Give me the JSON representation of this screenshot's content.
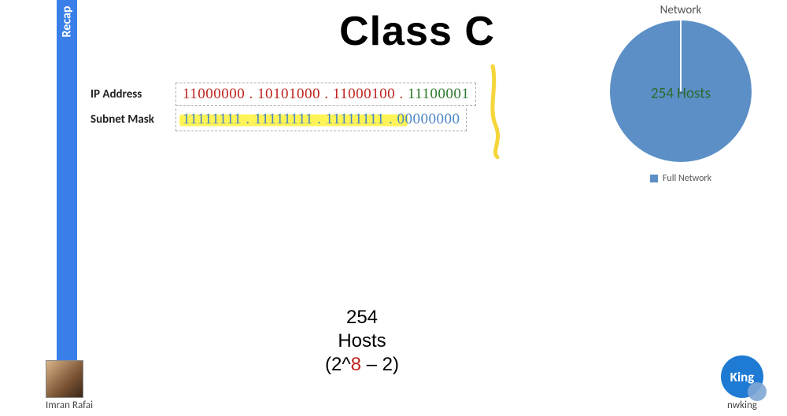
{
  "sidebar": {
    "label": "Recap"
  },
  "title": "Class C",
  "rows": {
    "ip": {
      "label": "IP Address",
      "network_bits": "11000000 . 10101000 . 11000100 .",
      "host_bits": " 11100001"
    },
    "mask": {
      "label": "Subnet Mask",
      "ones": "11111111 . 11111111 . 11111111 .",
      "zeros": " 00000000"
    }
  },
  "hostcalc": {
    "line1": "254",
    "line2": "Hosts",
    "formula_pre": "(2^",
    "formula_exp": "8",
    "formula_post": " – 2)"
  },
  "chart_data": {
    "type": "pie",
    "title": "Network",
    "series": [
      {
        "name": "Full Network",
        "value": 254,
        "color": "#5b8fc6"
      }
    ],
    "center_label": "254 Hosts",
    "legend": "Full Network"
  },
  "presenter": {
    "name": "Imran Rafai"
  },
  "brand": {
    "badge": "King",
    "name": "nwking"
  }
}
